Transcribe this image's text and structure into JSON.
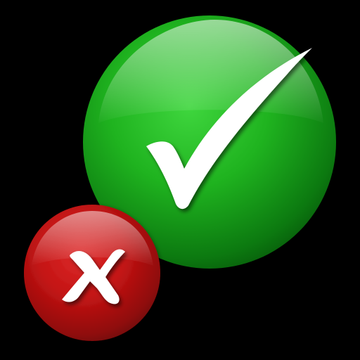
{
  "icon": {
    "primary": {
      "name": "check-icon",
      "state": "correct",
      "colors": {
        "highlight": "#7BF27A",
        "light": "#3FD63E",
        "base": "#1FB31F",
        "shadow": "#0C7A10",
        "dark": "#075A0A",
        "mark": "#FFFFFF"
      }
    },
    "secondary": {
      "name": "close-icon",
      "state": "wrong",
      "colors": {
        "highlight": "#F06A6A",
        "light": "#DE2B2B",
        "base": "#C41414",
        "shadow": "#8F0A0A",
        "dark": "#6A0505",
        "mark": "#FFFFFF"
      }
    },
    "background": "#000000"
  }
}
